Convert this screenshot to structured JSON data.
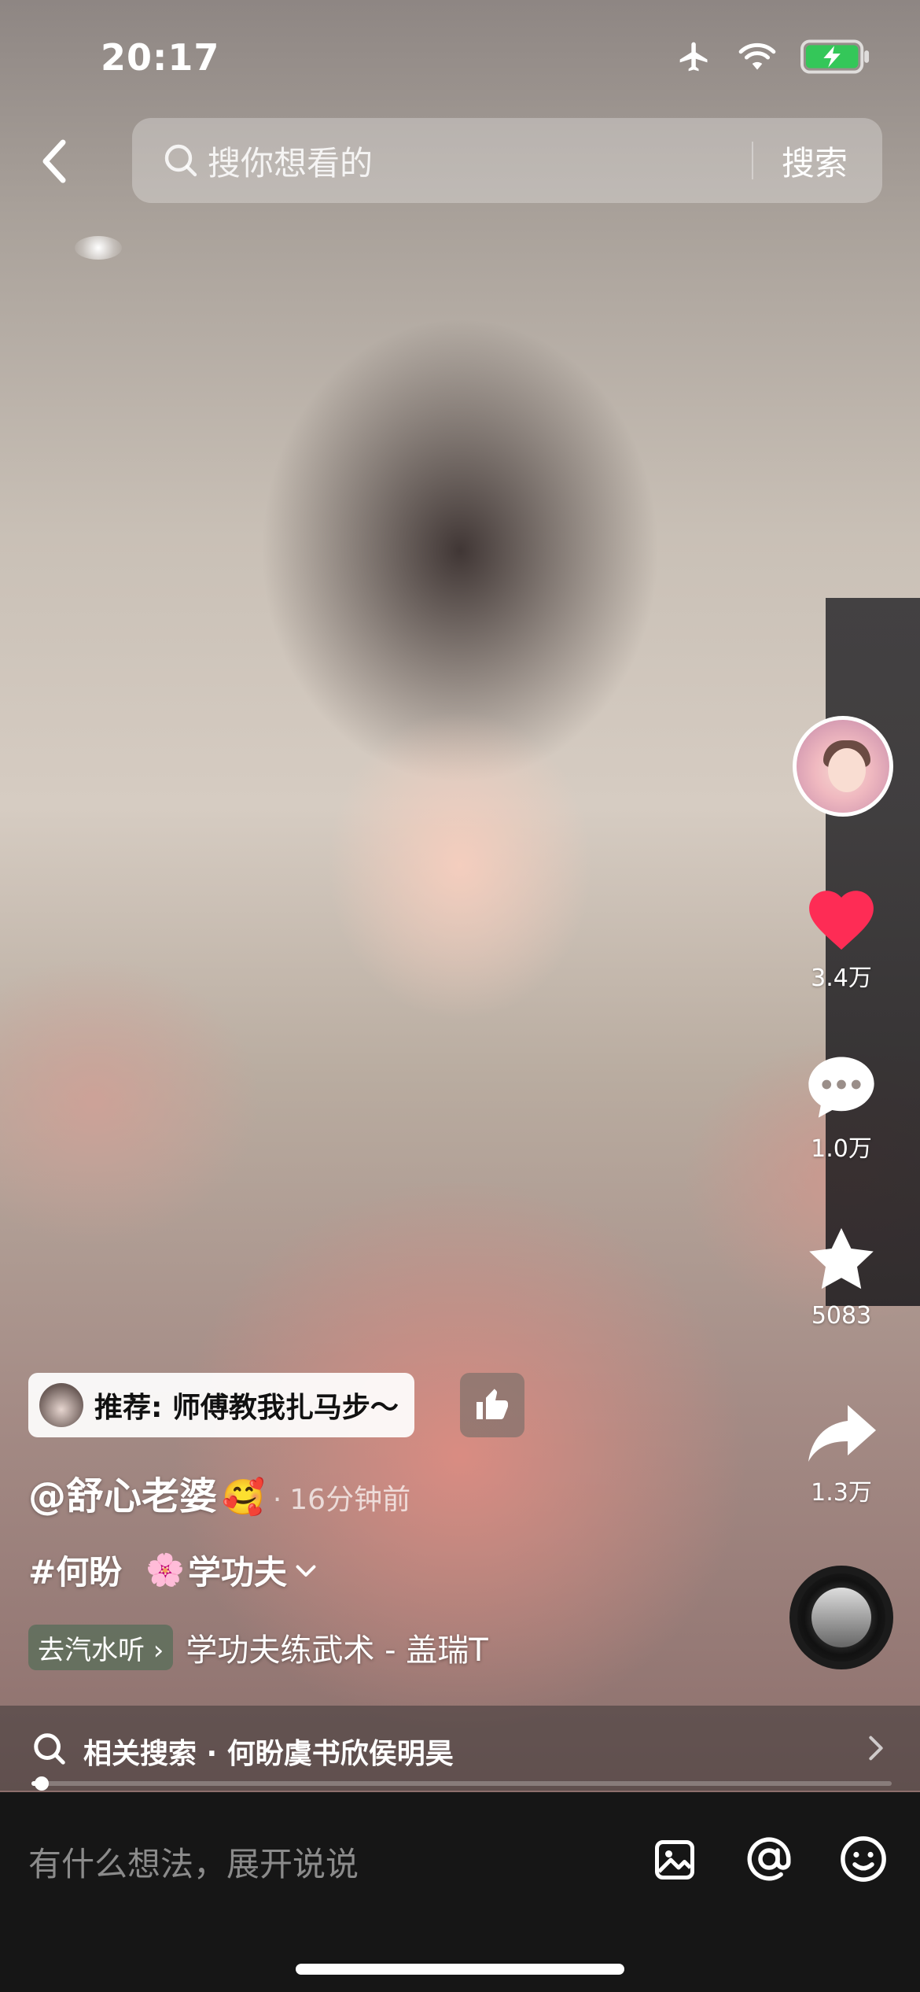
{
  "status_bar": {
    "time": "20:17"
  },
  "search": {
    "placeholder": "搜你想看的",
    "submit_label": "搜索"
  },
  "actions": {
    "like_count": "3.4万",
    "comment_count": "1.0万",
    "favorite_count": "5083",
    "share_count": "1.3万"
  },
  "post": {
    "recommend": "推荐: 师傅教我扎马步～",
    "author": "@舒心老婆",
    "author_emoji": "🥰",
    "separator": "·",
    "time_ago": "16分钟前",
    "tags": [
      "#何盼",
      "学功夫"
    ],
    "tag_emoji": "🌸",
    "music_chip": "去汽水听 ›",
    "music_title": "学功夫练武术 - 盖瑞T"
  },
  "related": {
    "text": "相关搜索 · 何盼虞书欣侯明昊"
  },
  "playback": {
    "progress_fraction": 0.012
  },
  "comment_bar": {
    "placeholder": "有什么想法，展开说说"
  },
  "colors": {
    "like_red": "#fe2c55",
    "bottom_bar": "#161616"
  }
}
